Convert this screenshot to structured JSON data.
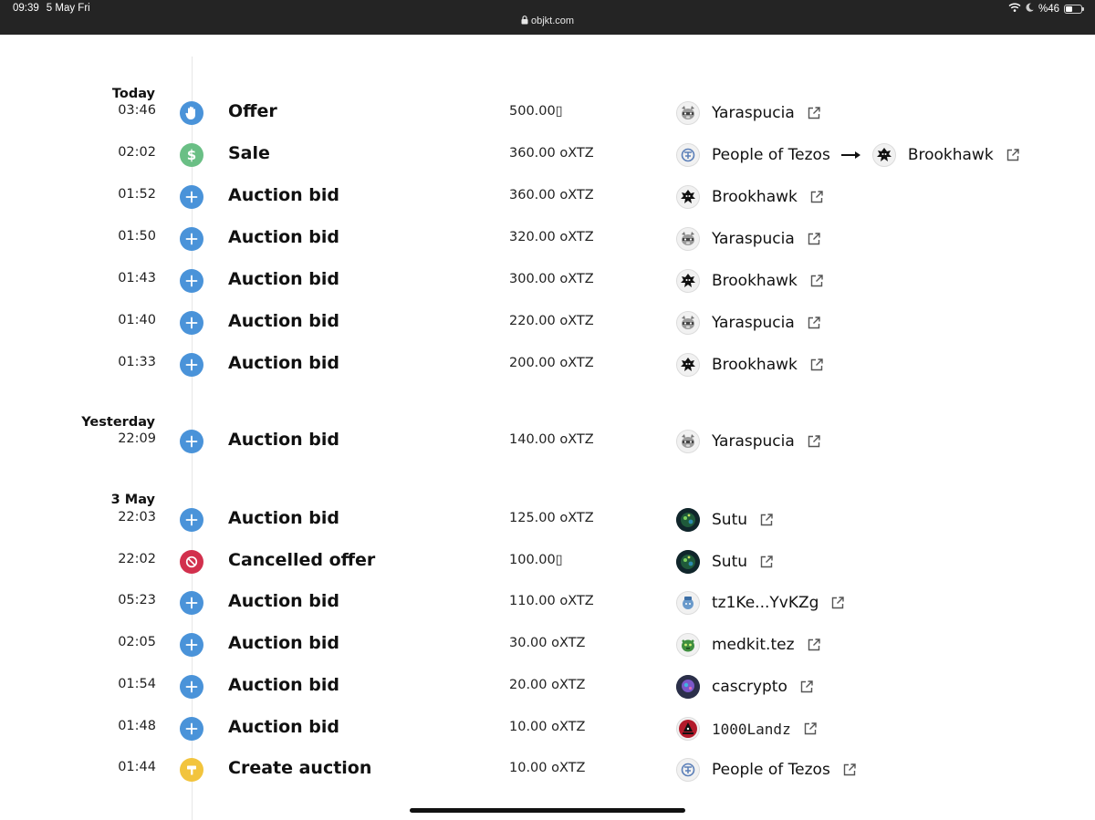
{
  "status_bar": {
    "time": "09:39",
    "date": "5 May Fri",
    "url": "objkt.com",
    "battery": "%46",
    "battery_level": 0.46
  },
  "colors": {
    "blue": "#4a93d9",
    "green": "#6abf85",
    "red": "#d2304d",
    "yellow": "#f2c43d"
  },
  "groups": {
    "today": "Today",
    "yesterday": "Yesterday",
    "may3": "3 May"
  },
  "events": [
    {
      "time": "03:46",
      "type": "Offer",
      "icon": "hand-icon",
      "price": "500.00▯",
      "user": "Yaraspucia"
    },
    {
      "time": "02:02",
      "type": "Sale",
      "icon": "dollar-icon",
      "price": "360.00 oXTZ",
      "user": "People of Tezos",
      "to_user": "Brookhawk"
    },
    {
      "time": "01:52",
      "type": "Auction bid",
      "icon": "plus-icon",
      "price": "360.00 oXTZ",
      "user": "Brookhawk"
    },
    {
      "time": "01:50",
      "type": "Auction bid",
      "icon": "plus-icon",
      "price": "320.00 oXTZ",
      "user": "Yaraspucia"
    },
    {
      "time": "01:43",
      "type": "Auction bid",
      "icon": "plus-icon",
      "price": "300.00 oXTZ",
      "user": "Brookhawk"
    },
    {
      "time": "01:40",
      "type": "Auction bid",
      "icon": "plus-icon",
      "price": "220.00 oXTZ",
      "user": "Yaraspucia"
    },
    {
      "time": "01:33",
      "type": "Auction bid",
      "icon": "plus-icon",
      "price": "200.00 oXTZ",
      "user": "Brookhawk"
    },
    {
      "time": "22:09",
      "type": "Auction bid",
      "icon": "plus-icon",
      "price": "140.00 oXTZ",
      "user": "Yaraspucia"
    },
    {
      "time": "22:03",
      "type": "Auction bid",
      "icon": "plus-icon",
      "price": "125.00 oXTZ",
      "user": "Sutu"
    },
    {
      "time": "22:02",
      "type": "Cancelled offer",
      "icon": "cancel-icon",
      "price": "100.00▯",
      "user": "Sutu"
    },
    {
      "time": "05:23",
      "type": "Auction bid",
      "icon": "plus-icon",
      "price": "110.00 oXTZ",
      "user": "tz1Ke...YvKZg"
    },
    {
      "time": "02:05",
      "type": "Auction bid",
      "icon": "plus-icon",
      "price": "30.00 oXTZ",
      "user": "medkit.tez"
    },
    {
      "time": "01:54",
      "type": "Auction bid",
      "icon": "plus-icon",
      "price": "20.00 oXTZ",
      "user": "cascrypto"
    },
    {
      "time": "01:48",
      "type": "Auction bid",
      "icon": "plus-icon",
      "price": "10.00 oXTZ",
      "user": "1000Landz"
    },
    {
      "time": "01:44",
      "type": "Create auction",
      "icon": "hammer-icon",
      "price": "10.00 oXTZ",
      "user": "People of Tezos"
    }
  ]
}
